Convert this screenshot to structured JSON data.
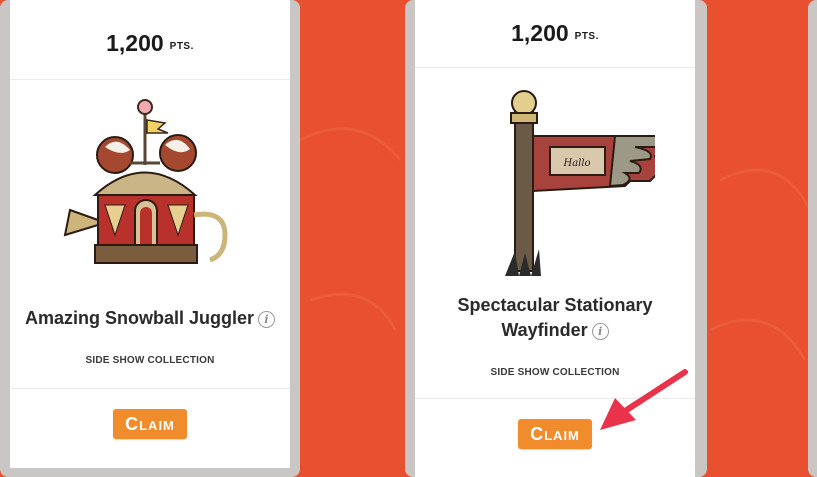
{
  "cards": [
    {
      "points_value": "1,200",
      "points_unit": "PTS.",
      "name": "Amazing Snowball Juggler",
      "info_icon": "i",
      "collection": "SIDE SHOW COLLECTION",
      "claim_label": "Claim"
    },
    {
      "points_value": "1,200",
      "points_unit": "PTS.",
      "name_line1": "Spectacular Stationary",
      "name_line2": "Wayfinder",
      "info_icon": "i",
      "collection": "SIDE SHOW COLLECTION",
      "claim_label": "Claim",
      "sign_text": "Hallo"
    }
  ],
  "colors": {
    "background": "#e8502f",
    "claim_button": "#f08c2b",
    "annotation_arrow": "#e8334a"
  },
  "icons": [
    "info-icon",
    "annotation-arrow-icon"
  ]
}
